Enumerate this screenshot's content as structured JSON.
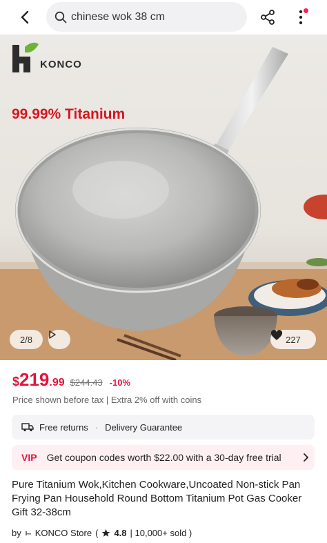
{
  "search": {
    "query": "chinese wok 38 cm"
  },
  "hero": {
    "brand_name": "KONCO",
    "tag": "99.99% Titanium",
    "counter": "2/8",
    "likes": "227"
  },
  "price": {
    "currency": "$",
    "integer": "219",
    "decimal": ".99",
    "original": "$244.43",
    "discount": "-10%",
    "note": "Price shown before tax | Extra 2% off with coins"
  },
  "returns": {
    "free_returns": "Free returns",
    "separator": "·",
    "delivery": "Delivery Guarantee"
  },
  "coupon": {
    "badge": "VIP",
    "text": "Get coupon codes worth $22.00 with a 30-day free trial"
  },
  "product": {
    "title": "Pure Titanium Wok,Kitchen Cookware,Uncoated Non-stick Pan Frying Pan Household Round Bottom Titanium Pot Gas Cooker Gift 32-38cm"
  },
  "store": {
    "by": "by",
    "name": "KONCO Store",
    "open": "(",
    "rating": "4.8",
    "sold": "| 10,000+ sold )"
  },
  "colors": {
    "accent": "#e5133a",
    "notification": "#ff1f4f",
    "hero_tag": "#d8151f"
  },
  "icons": [
    "back-arrow-icon",
    "search-icon",
    "share-icon",
    "more-vertical-icon",
    "play-icon",
    "heart-icon",
    "return-truck-icon",
    "chevron-right-icon",
    "star-icon",
    "store-icon"
  ]
}
